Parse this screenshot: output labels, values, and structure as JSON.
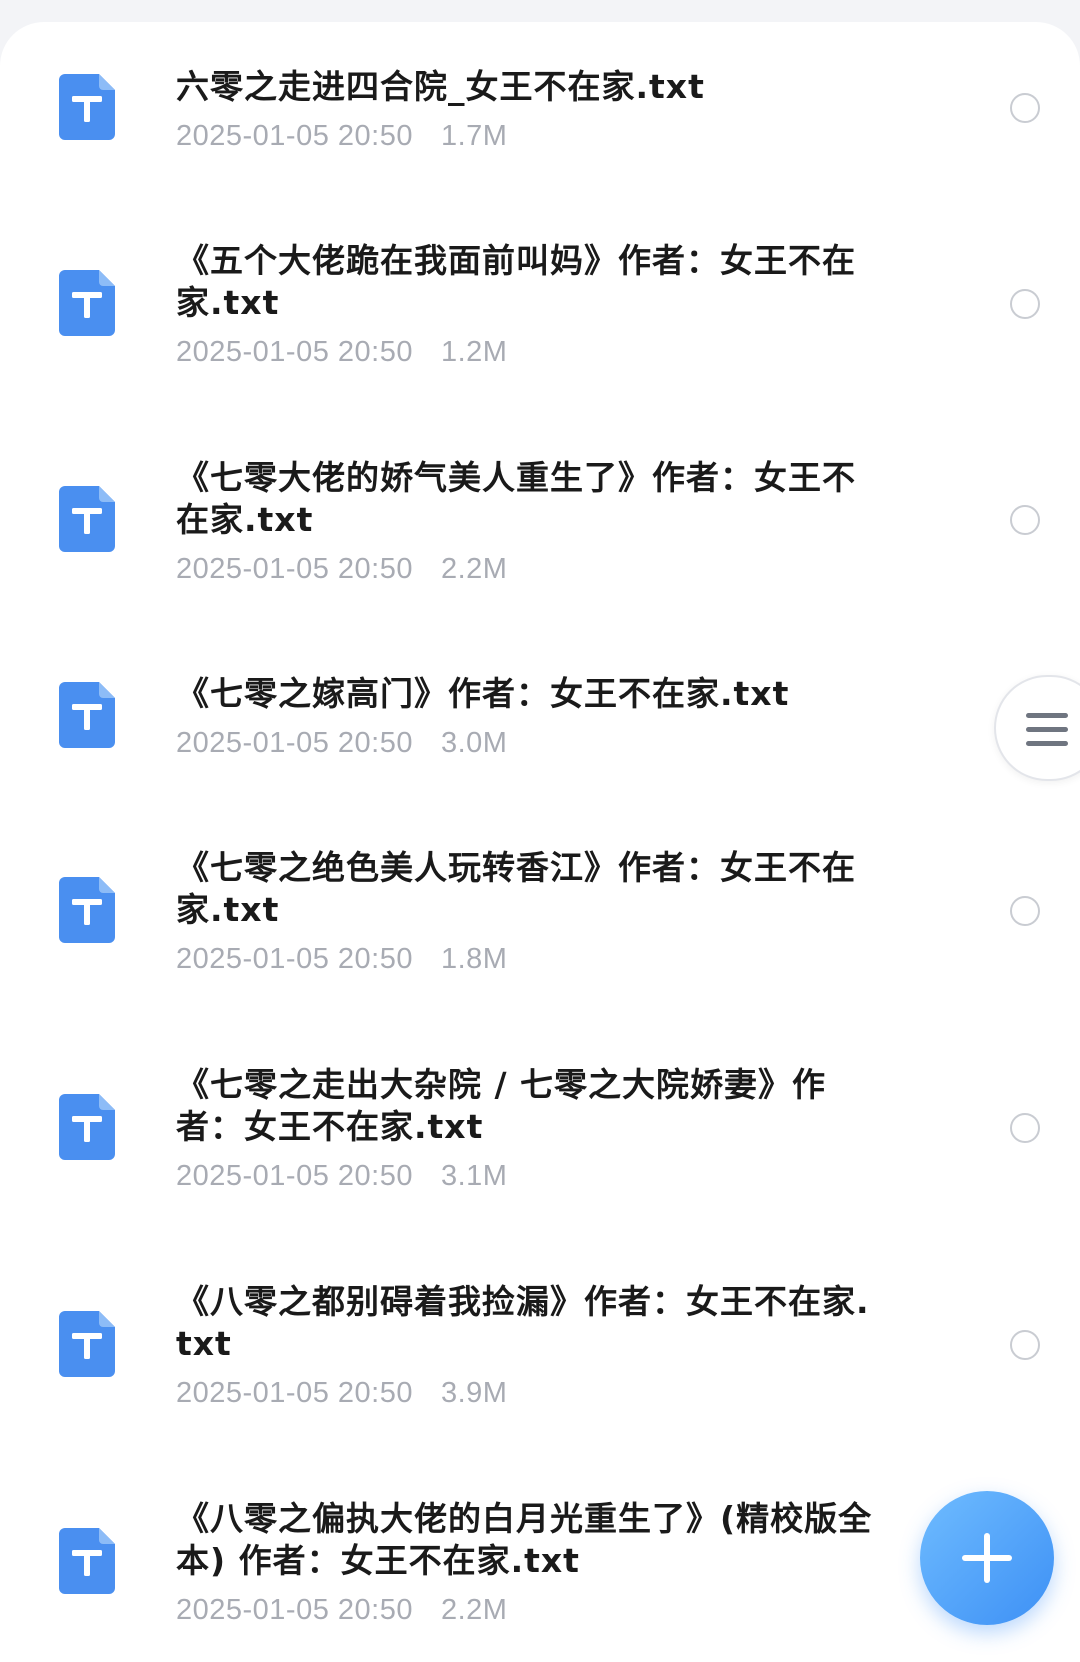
{
  "files": [
    {
      "name": "六零之走进四合院_女王不在家.txt",
      "date": "2025-01-05 20:50",
      "size": "1.7M",
      "icon": "txt-file-icon"
    },
    {
      "name": "《五个大佬跪在我面前叫妈》作者：女王不在家.txt",
      "date": "2025-01-05 20:50",
      "size": "1.2M",
      "icon": "txt-file-icon"
    },
    {
      "name": "《七零大佬的娇气美人重生了》作者：女王不在家.txt",
      "date": "2025-01-05 20:50",
      "size": "2.2M",
      "icon": "txt-file-icon"
    },
    {
      "name": "《七零之嫁高门》作者：女王不在家.txt",
      "date": "2025-01-05 20:50",
      "size": "3.0M",
      "icon": "txt-file-icon"
    },
    {
      "name": "《七零之绝色美人玩转香江》作者：女王不在家.txt",
      "date": "2025-01-05 20:50",
      "size": "1.8M",
      "icon": "txt-file-icon"
    },
    {
      "name": "《七零之走出大杂院 / 七零之大院娇妻》作者：女王不在家.txt",
      "date": "2025-01-05 20:50",
      "size": "3.1M",
      "icon": "txt-file-icon"
    },
    {
      "name": "《八零之都别碍着我捡漏》作者：女王不在家.txt",
      "date": "2025-01-05 20:50",
      "size": "3.9M",
      "icon": "txt-file-icon"
    },
    {
      "name": "《八零之偏执大佬的白月光重生了》(精校版全本) 作者：女王不在家.txt",
      "date": "2025-01-05 20:50",
      "size": "2.2M",
      "icon": "txt-file-icon"
    }
  ],
  "side_menu": {
    "icon": "menu-icon"
  },
  "fab": {
    "icon": "plus-icon"
  },
  "colors": {
    "accent": "#3d90f5",
    "icon_blue": "#4a8ff0",
    "meta_gray": "#a8abb3"
  }
}
